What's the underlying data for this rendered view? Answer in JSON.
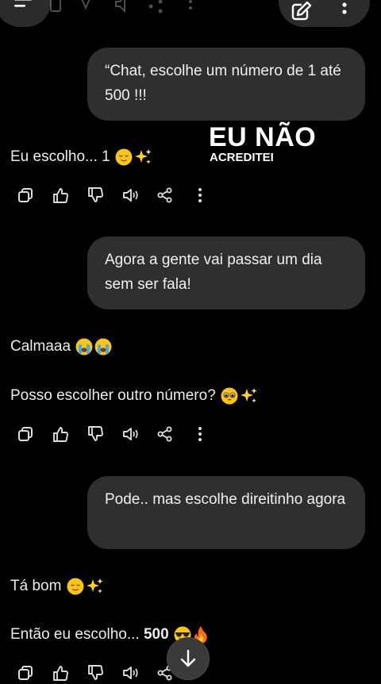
{
  "overlay": {
    "title": "EU NÃO",
    "subtitle": "ACREDITEI"
  },
  "messages": {
    "user1": "“Chat, escolhe um número de 1 até 500 !!!",
    "ai1": "Eu escolho... 1",
    "user2": "Agora  a gente  vai passar  um dia sem ser fala!",
    "ai2a": "Calmaaa",
    "ai2b": "Posso escolher outro número?",
    "user3": "Pode..  mas escolhe  direitinho agora",
    "ai3a": "Tá bom",
    "ai3b": "Então eu escolho...",
    "ai3b_number": "500"
  },
  "icons": {
    "menu": "menu-icon",
    "edit": "new-chat-icon",
    "more": "more-vert-icon",
    "copy": "copy-icon",
    "like": "thumbs-up-icon",
    "dislike": "thumbs-down-icon",
    "speak": "read-aloud-icon",
    "share": "share-icon",
    "scroll": "arrow-down-icon"
  },
  "colors": {
    "background": "#000000",
    "bubble": "#2f2f2f",
    "text": "#ececec"
  }
}
